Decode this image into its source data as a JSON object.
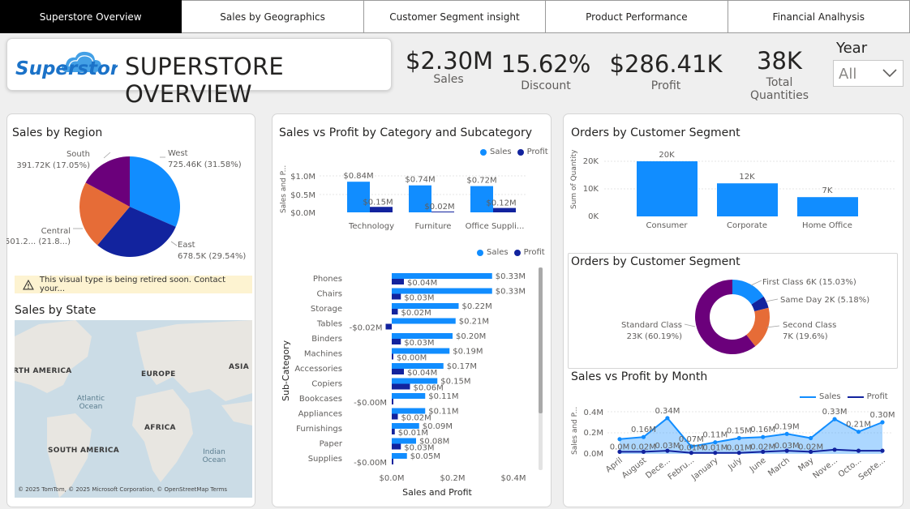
{
  "tabs": [
    "Superstore Overview",
    "Sales by Geographics",
    "Customer Segment insight",
    "Product Performance",
    "Financial Analhysis"
  ],
  "header": {
    "logo_text": "Superstore",
    "title": "SUPERSTORE OVERVIEW"
  },
  "kpis": [
    {
      "value": "$2.30M",
      "label": "Sales"
    },
    {
      "value": "15.62%",
      "label": "Discount"
    },
    {
      "value": "$286.41K",
      "label": "Profit"
    },
    {
      "value": "38K",
      "label": "Total Quantities"
    }
  ],
  "year_filter": {
    "label": "Year",
    "value": "All"
  },
  "colors": {
    "sales": "#118dff",
    "profit": "#12239e",
    "orange": "#e66c37",
    "purple": "#6b007b"
  },
  "region_panel": {
    "title": "Sales by Region",
    "labels": {
      "west_name": "West",
      "west_value": "725.46K (31.58%)",
      "south_name": "South",
      "south_value": "391.72K (17.05%)",
      "central_name": "Central",
      "central_value": "501.2... (21.8...)",
      "east_name": "East",
      "east_value": "678.5K (29.54%)"
    }
  },
  "warning": {
    "text": "This visual type is being retired soon. Contact your..."
  },
  "state_map": {
    "title": "Sales by State",
    "labels": {
      "north_america": "RTH AMERICA",
      "europe": "EUROPE",
      "asia": "ASIA",
      "atlantic": "Atlantic Ocean",
      "africa": "AFRICA",
      "south_america": "SOUTH AMERICA",
      "indian": "Indian Ocean"
    },
    "attribution": "© 2025 TomTom, © 2025 Microsoft Corporation, © OpenStreetMap  Terms"
  },
  "category_panel": {
    "title": "Sales vs Profit by Category and Subcategory",
    "legend_sales": "Sales",
    "legend_profit": "Profit",
    "top_ylabel": "Sales and P...",
    "top_ticks": [
      "$1.0M",
      "$0.5M",
      "$0.0M"
    ],
    "subcat_ylabel": "Sub-Category",
    "subcat_xlabel": "Sales and Profit",
    "subcat_ticks": [
      "$0.0M",
      "$0.2M",
      "$0.4M"
    ]
  },
  "segment_bar_panel": {
    "title": "Orders by Customer Segment",
    "ylabel": "Sum of Quantity",
    "ticks": [
      "20K",
      "10K",
      "0K"
    ]
  },
  "segment_donut_panel": {
    "title": "Orders by Customer Segment",
    "labels": {
      "first_name": "First Class 6K (15.03%)",
      "sameday_name": "Same Day 2K (5.18%)",
      "standard_name": "Standard Class",
      "standard_value": "23K (60.19%)",
      "second_name": "Second Class",
      "second_value": "7K (19.6%)"
    }
  },
  "month_panel": {
    "title": "Sales vs Profit by Month",
    "legend_sales": "Sales",
    "legend_profit": "Profit",
    "ylabel": "Sales and P...",
    "ticks": [
      "0.4M",
      "0.2M",
      "0.0M"
    ]
  },
  "chart_data": [
    {
      "type": "pie",
      "title": "Sales by Region",
      "categories": [
        "West",
        "East",
        "Central",
        "South"
      ],
      "values": [
        725.46,
        678.5,
        501.2,
        391.72
      ],
      "percents": [
        31.58,
        29.54,
        21.8,
        17.05
      ],
      "colors": [
        "#118dff",
        "#12239e",
        "#e66c37",
        "#6b007b"
      ]
    },
    {
      "type": "bar",
      "title": "Sales vs Profit by Category and Subcategory",
      "categories": [
        "Technology",
        "Furniture",
        "Office Suppli..."
      ],
      "series": [
        {
          "name": "Sales",
          "values": [
            0.84,
            0.74,
            0.72
          ],
          "labels": [
            "$0.84M",
            "$0.74M",
            "$0.72M"
          ]
        },
        {
          "name": "Profit",
          "values": [
            0.15,
            0.02,
            0.12
          ],
          "labels": [
            "$0.15M",
            "$0.02M",
            "$0.12M"
          ]
        }
      ],
      "ylim": [
        0,
        1.0
      ]
    },
    {
      "type": "bar",
      "orientation": "horizontal",
      "categories": [
        "Phones",
        "Chairs",
        "Storage",
        "Tables",
        "Binders",
        "Machines",
        "Accessories",
        "Copiers",
        "Bookcases",
        "Appliances",
        "Furnishings",
        "Paper",
        "Supplies"
      ],
      "series": [
        {
          "name": "Sales",
          "values": [
            0.33,
            0.33,
            0.22,
            0.21,
            0.2,
            0.19,
            0.17,
            0.15,
            0.11,
            0.11,
            0.09,
            0.08,
            0.05
          ],
          "labels": [
            "$0.33M",
            "$0.33M",
            "$0.22M",
            "$0.21M",
            "$0.20M",
            "$0.19M",
            "$0.17M",
            "$0.15M",
            "$0.11M",
            "$0.11M",
            "$0.09M",
            "$0.08M",
            "$0.05M"
          ]
        },
        {
          "name": "Profit",
          "values": [
            0.04,
            0.03,
            0.02,
            -0.02,
            0.03,
            0.0,
            0.04,
            0.06,
            -0.0,
            0.02,
            0.01,
            0.03,
            -0.0
          ],
          "labels": [
            "$0.04M",
            "$0.03M",
            "$0.02M",
            "-$0.02M",
            "$0.03M",
            "$0.00M",
            "$0.04M",
            "$0.06M",
            "-$0.00M",
            "$0.02M",
            "$0.01M",
            "$0.03M",
            "-$0.00M"
          ]
        }
      ],
      "xlim": [
        0,
        0.4
      ],
      "ylabel": "Sub-Category",
      "xlabel": "Sales and Profit"
    },
    {
      "type": "bar",
      "title": "Orders by Customer Segment",
      "categories": [
        "Consumer",
        "Corporate",
        "Home Office"
      ],
      "values": [
        20,
        12,
        7
      ],
      "labels": [
        "20K",
        "12K",
        "7K"
      ],
      "ylim": [
        0,
        20
      ],
      "ylabel": "Sum of Quantity"
    },
    {
      "type": "pie",
      "style": "donut",
      "title": "Orders by Customer Segment",
      "categories": [
        "First Class",
        "Same Day",
        "Second Class",
        "Standard Class"
      ],
      "values": [
        6,
        2,
        7,
        23
      ],
      "percents": [
        15.03,
        5.18,
        19.6,
        60.19
      ],
      "colors": [
        "#118dff",
        "#12239e",
        "#e66c37",
        "#6b007b"
      ]
    },
    {
      "type": "area",
      "title": "Sales vs Profit by Month",
      "categories": [
        "April",
        "August",
        "Dece...",
        "Febru...",
        "January",
        "July",
        "June",
        "March",
        "May",
        "Nove...",
        "Octo...",
        "Septe..."
      ],
      "series": [
        {
          "name": "Sales",
          "values": [
            0.14,
            0.16,
            0.34,
            0.07,
            0.11,
            0.15,
            0.16,
            0.19,
            0.15,
            0.33,
            0.21,
            0.3
          ],
          "labels": [
            "",
            "0.16M",
            "0.34M",
            "0.07M",
            "0.11M",
            "0.15M",
            "0.16M",
            "0.19M",
            "",
            "0.33M",
            "0.21M",
            "0.30M"
          ]
        },
        {
          "name": "Profit",
          "values": [
            0.02,
            0.02,
            0.03,
            0.01,
            0.01,
            0.01,
            0.02,
            0.03,
            0.02,
            0.04,
            0.03,
            0.03
          ],
          "labels": [
            "0.0M",
            "0.02M",
            "0.03M",
            "0.01M",
            "0.01M",
            "0.01M",
            "0.02M",
            "0.03M",
            "0.02M",
            "",
            "",
            ""
          ]
        }
      ],
      "ylim": [
        0,
        0.4
      ]
    }
  ]
}
